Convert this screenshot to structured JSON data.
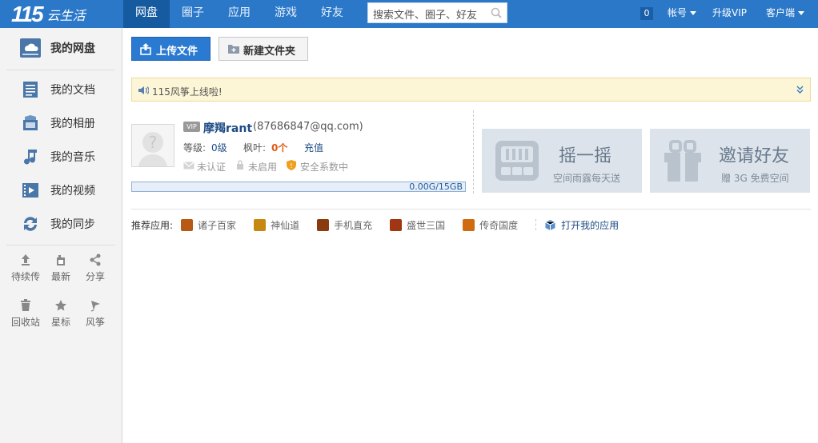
{
  "brand": {
    "logo_number": "115",
    "logo_text": "云生活"
  },
  "nav": {
    "items": [
      {
        "label": "网盘",
        "active": true
      },
      {
        "label": "圈子"
      },
      {
        "label": "应用"
      },
      {
        "label": "游戏"
      },
      {
        "label": "好友"
      }
    ]
  },
  "search": {
    "placeholder": "搜索文件、圈子、好友"
  },
  "topright": {
    "count": "0",
    "account": "帐号",
    "upgrade": "升级VIP",
    "client": "客户端"
  },
  "sidebar": {
    "items": [
      {
        "label": "我的网盘"
      },
      {
        "label": "我的文档"
      },
      {
        "label": "我的相册"
      },
      {
        "label": "我的音乐"
      },
      {
        "label": "我的视频"
      },
      {
        "label": "我的同步"
      }
    ],
    "tools": [
      {
        "label": "待续传"
      },
      {
        "label": "最新"
      },
      {
        "label": "分享"
      },
      {
        "label": "回收站"
      },
      {
        "label": "星标"
      },
      {
        "label": "风筝"
      }
    ]
  },
  "toolbar": {
    "upload": "上传文件",
    "new_folder": "新建文件夹"
  },
  "notice": {
    "text": "115风筝上线啦!"
  },
  "user": {
    "vip_badge": "VIP",
    "name": "摩羯rant",
    "email": "(87686847@qq.com)",
    "level_label": "等级:",
    "level_value": "0级",
    "maple_label": "枫叶:",
    "maple_value": "0个",
    "recharge": "充值",
    "auth": "未认证",
    "enabled": "未启用",
    "security": "安全系数中",
    "storage_text": "0.00G/15GB",
    "storage_used_fraction": 0.0
  },
  "cards": {
    "shake": {
      "title": "摇一摇",
      "subtitle": "空间雨露每天送"
    },
    "invite": {
      "title": "邀请好友",
      "subtitle": "赠 3G 免费空间"
    }
  },
  "apps": {
    "title": "推荐应用:",
    "items": [
      {
        "label": "诸子百家",
        "color": "#b85a13"
      },
      {
        "label": "神仙道",
        "color": "#c78812"
      },
      {
        "label": "手机直充",
        "color": "#8b3a10"
      },
      {
        "label": "盛世三国",
        "color": "#a13712"
      },
      {
        "label": "传奇国度",
        "color": "#d06b10"
      }
    ],
    "open_label": "打开我的应用"
  },
  "colors": {
    "topbar": "#2b78c9",
    "nav_active": "#165a9f",
    "primary": "#2b7ad1",
    "maple_value": "#e05a14"
  }
}
